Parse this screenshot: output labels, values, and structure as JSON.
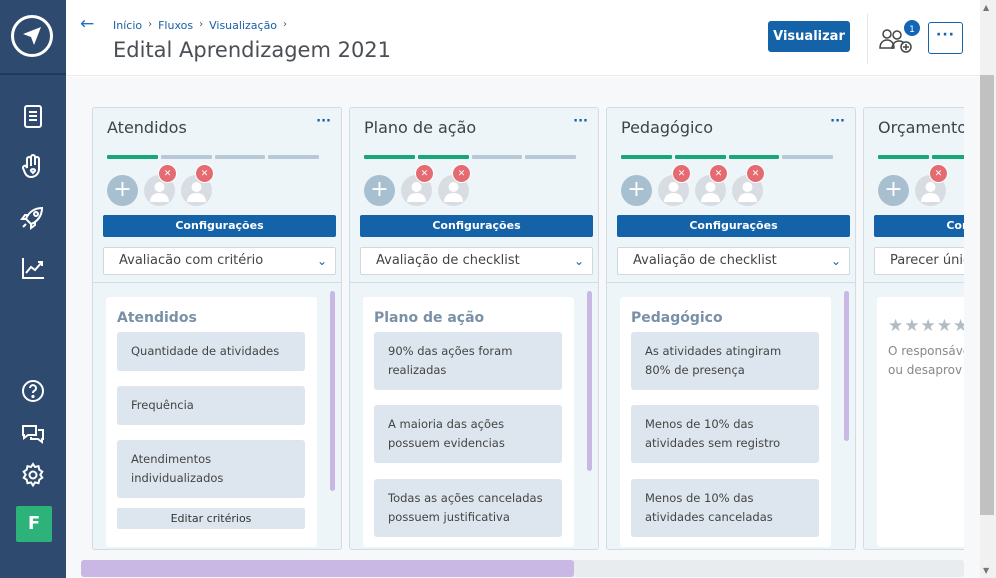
{
  "breadcrumb": [
    "Início",
    "Fluxos",
    "Visualização"
  ],
  "page_title": "Edital Aprendizagem 2021",
  "header": {
    "visualizar_label": "Visualizar",
    "users_badge": "1",
    "more_label": "···"
  },
  "columns": [
    {
      "title": "Atendidos",
      "progress": [
        true,
        false,
        false,
        false
      ],
      "members": 2,
      "config_label": "Configurações",
      "select_value": "Avaliacão com critério",
      "inner_title": "Atendidos",
      "criteria": [
        "Quantidade de atividades",
        "Frequência",
        "Atendimentos individualizados"
      ],
      "edit_label": "Editar critérios"
    },
    {
      "title": "Plano de ação",
      "progress": [
        true,
        true,
        false,
        false
      ],
      "members": 2,
      "config_label": "Configurações",
      "select_value": "Avaliação de checklist",
      "inner_title": "Plano de ação",
      "criteria": [
        "90% das ações foram realizadas",
        "A maioria das ações possuem evidencias",
        "Todas as ações canceladas possuem justificativa"
      ]
    },
    {
      "title": "Pedagógico",
      "progress": [
        true,
        true,
        true,
        false
      ],
      "members": 3,
      "config_label": "Configurações",
      "select_value": "Avaliação de checklist",
      "inner_title": "Pedagógico",
      "criteria": [
        "As atividades atingiram 80% de presença",
        "Menos de 10% das atividades sem registro",
        "Menos de 10% das atividades canceladas"
      ]
    },
    {
      "title": "Orçamento",
      "progress": [
        true,
        true,
        true,
        true
      ],
      "members": 1,
      "config_label": "Configurações",
      "select_value": "Parecer único",
      "stars": "★★★★★",
      "resp_text": [
        "O responsável",
        "ou desaprov"
      ]
    }
  ],
  "colors": {
    "sidebar": "#2e4a6e",
    "primary": "#1463a8",
    "progress_on": "#19a779",
    "remove": "#e46b71"
  }
}
